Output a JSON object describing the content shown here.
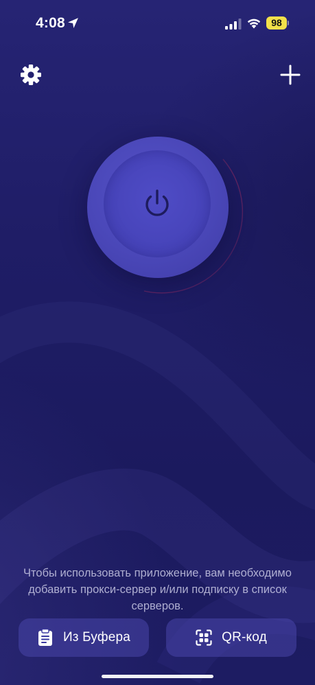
{
  "status_bar": {
    "time": "4:08",
    "battery_level": "98",
    "battery_color": "#f1e04a",
    "icons": [
      "location-arrow-icon",
      "cellular-signal-icon",
      "wifi-icon",
      "battery-icon"
    ]
  },
  "toolbar": {
    "settings_icon": "gear-icon",
    "add_icon": "plus-icon"
  },
  "connect": {
    "icon": "power-icon",
    "state": "disconnected"
  },
  "hint": {
    "text": "Чтобы использовать приложение, вам необходимо добавить прокси-сервер и/или подписку в список серверов."
  },
  "actions": {
    "clipboard_label": "Из Буфера",
    "clipboard_icon": "clipboard-icon",
    "qr_label": "QR-код",
    "qr_icon": "qr-scan-icon"
  },
  "colors": {
    "background": "#211f6a",
    "accent": "#4a47b8",
    "button_bg": "#3b39a0",
    "ring": "#8a2a5a"
  }
}
